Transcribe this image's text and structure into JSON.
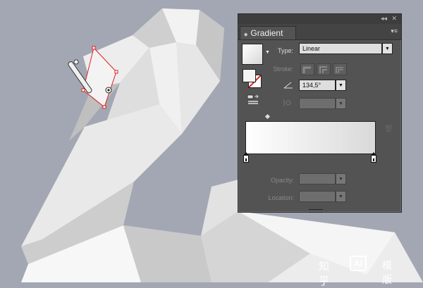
{
  "panel": {
    "tab_label": "Gradient",
    "collapse_icon": "double-chevron-icon",
    "close_icon": "close-icon",
    "menu_icon": "panel-menu-icon",
    "type_label": "Type:",
    "type_value": "Linear",
    "stroke_label": "Stroke:",
    "angle_value": "134,5°",
    "opacity_label": "Opacity:",
    "location_label": "Location:",
    "stroke_mode_icons": [
      "stroke-within-icon",
      "stroke-along-icon",
      "stroke-across-icon"
    ],
    "gradient_colors": [
      "#ffffff",
      "#d9d9d9"
    ]
  },
  "watermark": {
    "text1": "知乎",
    "logo": "AI",
    "text2": "模版"
  },
  "colors": {
    "canvas_bg": "#a2a7b3",
    "panel_bg": "#535353",
    "selection_accent": "#e01e1e"
  }
}
